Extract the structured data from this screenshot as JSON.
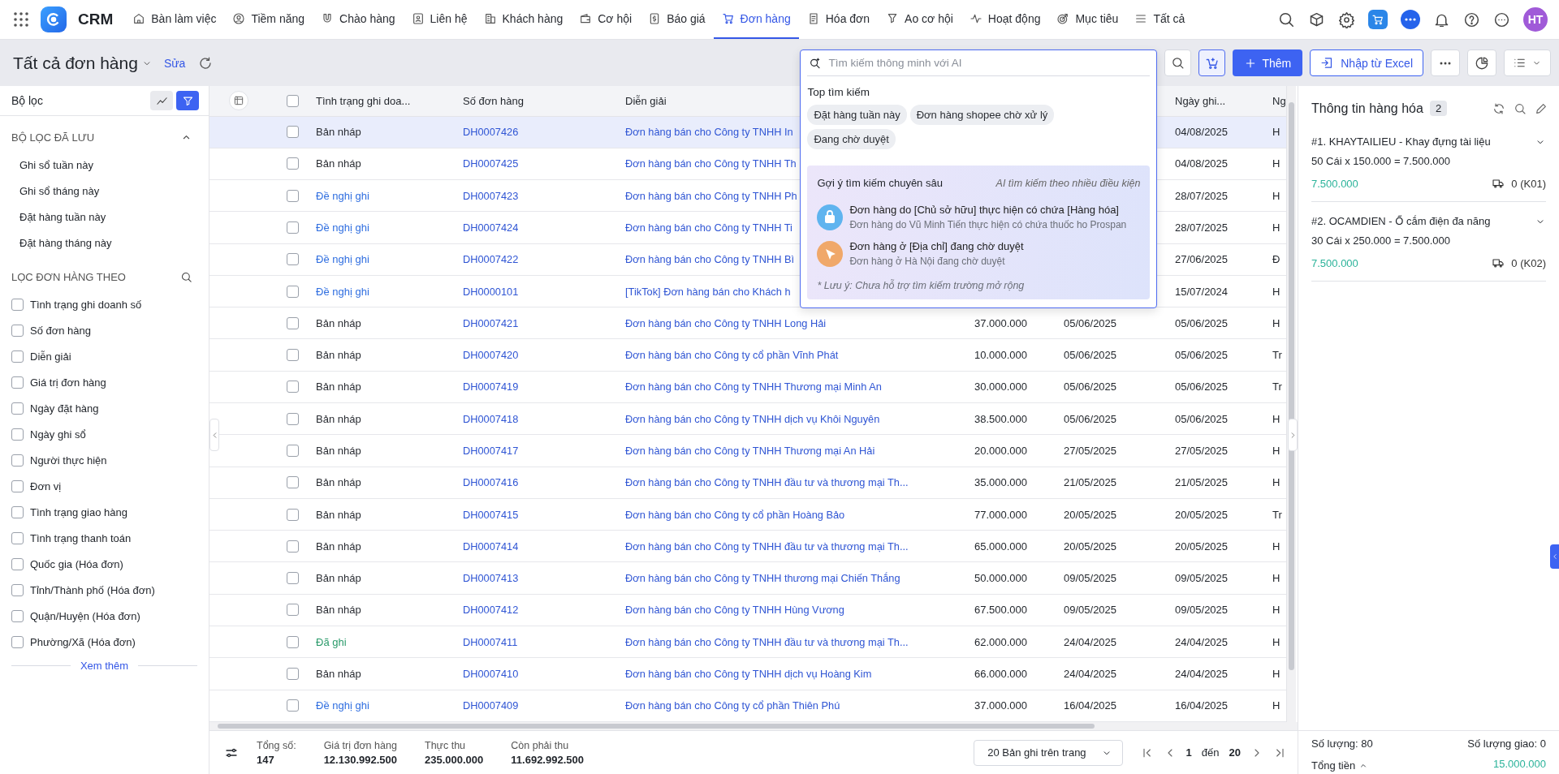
{
  "app": {
    "name": "CRM"
  },
  "nav": [
    {
      "label": "Bàn làm việc",
      "selected": false
    },
    {
      "label": "Tiềm năng",
      "selected": false
    },
    {
      "label": "Chào hàng",
      "selected": false
    },
    {
      "label": "Liên hệ",
      "selected": false
    },
    {
      "label": "Khách hàng",
      "selected": false
    },
    {
      "label": "Cơ hội",
      "selected": false
    },
    {
      "label": "Báo giá",
      "selected": false
    },
    {
      "label": "Đơn hàng",
      "selected": true
    },
    {
      "label": "Hóa đơn",
      "selected": false
    },
    {
      "label": "Ao cơ hội",
      "selected": false
    },
    {
      "label": "Hoạt động",
      "selected": false
    },
    {
      "label": "Mục tiêu",
      "selected": false
    },
    {
      "label": "Tất cả",
      "selected": false
    }
  ],
  "user": {
    "initials": "HT"
  },
  "toolbar": {
    "title": "Tất cả đơn hàng",
    "edit_link": "Sửa",
    "add_button": "Thêm",
    "import_button": "Nhập từ Excel"
  },
  "search": {
    "placeholder": "Tìm kiếm thông minh với AI",
    "top_title": "Top tìm kiếm",
    "chips": [
      "Đặt hàng tuần này",
      "Đơn hàng shopee chờ xử lý",
      "Đang chờ duyệt"
    ],
    "deep": {
      "title": "Gợi ý tìm kiếm chuyên sâu",
      "subtitle": "AI tìm kiếm theo nhiều điều kiện",
      "suggestions": [
        {
          "title": "Đơn hàng do [Chủ sở hữu] thực hiện có chứa [Hàng hóa]",
          "example": "Đơn hàng do Vũ Minh Tiến thực hiện có chứa thuốc ho Prospan"
        },
        {
          "title": "Đơn hàng ở [Địa chỉ] đang chờ duyệt",
          "example": "Đơn hàng ở Hà Nội đang chờ duyệt"
        }
      ],
      "note": "* Lưu ý: Chưa hỗ trợ tìm kiếm trường mở rộng"
    }
  },
  "filters": {
    "title": "Bộ lọc",
    "saved_title": "BỘ LỌC ĐÃ LƯU",
    "saved_expanded": true,
    "saved": [
      "Ghi sổ tuần này",
      "Ghi sổ tháng này",
      "Đặt hàng tuần này",
      "Đặt hàng tháng này"
    ],
    "by_title": "LỌC ĐƠN HÀNG THEO",
    "fields": [
      {
        "label": "Tình trạng ghi doanh số",
        "checked": false
      },
      {
        "label": "Số đơn hàng",
        "checked": false
      },
      {
        "label": "Diễn giải",
        "checked": false
      },
      {
        "label": "Giá trị đơn hàng",
        "checked": false
      },
      {
        "label": "Ngày đặt hàng",
        "checked": false
      },
      {
        "label": "Ngày ghi sổ",
        "checked": false
      },
      {
        "label": "Người thực hiện",
        "checked": false
      },
      {
        "label": "Đơn vị",
        "checked": false
      },
      {
        "label": "Tình trạng giao hàng",
        "checked": false
      },
      {
        "label": "Tình trạng thanh toán",
        "checked": false
      },
      {
        "label": "Quốc gia (Hóa đơn)",
        "checked": false
      },
      {
        "label": "Tỉnh/Thành phố (Hóa đơn)",
        "checked": false
      },
      {
        "label": "Quận/Huyện (Hóa đơn)",
        "checked": false
      },
      {
        "label": "Phường/Xã (Hóa đơn)",
        "checked": false
      }
    ],
    "more": "Xem thêm"
  },
  "table": {
    "headers": {
      "status": "Tình trạng ghi doa...",
      "number": "Số đơn hàng",
      "description": "Diễn giải",
      "record_date": "Ngày ghi...",
      "column_8": "Ng"
    },
    "all_checked": false,
    "rows": [
      {
        "selected": true,
        "checked": false,
        "status": "Bản nháp",
        "color": "#2a2d33",
        "number": "DH0007426",
        "description": "Đơn hàng bán cho Công ty TNHH In",
        "record_date": "04/08/2025",
        "column_8": "H"
      },
      {
        "selected": false,
        "checked": false,
        "status": "Bản nháp",
        "color": "#2a2d33",
        "number": "DH0007425",
        "description": "Đơn hàng bán cho Công ty TNHH Th",
        "record_date": "04/08/2025",
        "column_8": "H"
      },
      {
        "selected": false,
        "checked": false,
        "status": "Đề nghị ghi",
        "color": "#2f6ee0",
        "number": "DH0007423",
        "description": "Đơn hàng bán cho Công ty TNHH Ph",
        "record_date": "28/07/2025",
        "column_8": "H"
      },
      {
        "selected": false,
        "checked": false,
        "status": "Đề nghị ghi",
        "color": "#2f6ee0",
        "number": "DH0007424",
        "description": "Đơn hàng bán cho Công ty TNHH Ti",
        "record_date": "28/07/2025",
        "column_8": "H"
      },
      {
        "selected": false,
        "checked": false,
        "status": "Đề nghị ghi",
        "color": "#2f6ee0",
        "number": "DH0007422",
        "description": "Đơn hàng bán cho Công ty TNHH Bì",
        "record_date": "27/06/2025",
        "column_8": "Đ"
      },
      {
        "selected": false,
        "checked": false,
        "status": "Đề nghị ghi",
        "color": "#2f6ee0",
        "number": "DH0000101",
        "description": "[TikTok] Đơn hàng bán cho Khách h",
        "record_date": "15/07/2024",
        "column_8": "H"
      },
      {
        "selected": false,
        "checked": false,
        "status": "Bản nháp",
        "color": "#2a2d33",
        "number": "DH0007421",
        "description": "Đơn hàng bán cho Công ty TNHH Long Hải",
        "value": "37.000.000",
        "order_date": "05/06/2025",
        "record_date": "05/06/2025",
        "column_8": "H"
      },
      {
        "selected": false,
        "checked": false,
        "status": "Bản nháp",
        "color": "#2a2d33",
        "number": "DH0007420",
        "description": "Đơn hàng bán cho Công ty cổ phần Vĩnh Phát",
        "value": "10.000.000",
        "order_date": "05/06/2025",
        "record_date": "05/06/2025",
        "column_8": "Tr"
      },
      {
        "selected": false,
        "checked": false,
        "status": "Bản nháp",
        "color": "#2a2d33",
        "number": "DH0007419",
        "description": "Đơn hàng bán cho Công ty TNHH Thương mại Minh An",
        "value": "30.000.000",
        "order_date": "05/06/2025",
        "record_date": "05/06/2025",
        "column_8": "Tr"
      },
      {
        "selected": false,
        "checked": false,
        "status": "Bản nháp",
        "color": "#2a2d33",
        "number": "DH0007418",
        "description": "Đơn hàng bán cho Công ty TNHH dịch vụ Khôi Nguyên",
        "value": "38.500.000",
        "order_date": "05/06/2025",
        "record_date": "05/06/2025",
        "column_8": "H"
      },
      {
        "selected": false,
        "checked": false,
        "status": "Bản nháp",
        "color": "#2a2d33",
        "number": "DH0007417",
        "description": "Đơn hàng bán cho Công ty TNHH Thương mại An Hải",
        "value": "20.000.000",
        "order_date": "27/05/2025",
        "record_date": "27/05/2025",
        "column_8": "H"
      },
      {
        "selected": false,
        "checked": false,
        "status": "Bản nháp",
        "color": "#2a2d33",
        "number": "DH0007416",
        "description": "Đơn hàng bán cho Công ty TNHH đầu tư và thương mại Th...",
        "value": "35.000.000",
        "order_date": "21/05/2025",
        "record_date": "21/05/2025",
        "column_8": "H"
      },
      {
        "selected": false,
        "checked": false,
        "status": "Bản nháp",
        "color": "#2a2d33",
        "number": "DH0007415",
        "description": "Đơn hàng bán cho Công ty cổ phần Hoàng Bảo",
        "value": "77.000.000",
        "order_date": "20/05/2025",
        "record_date": "20/05/2025",
        "column_8": "Tr"
      },
      {
        "selected": false,
        "checked": false,
        "status": "Bản nháp",
        "color": "#2a2d33",
        "number": "DH0007414",
        "description": "Đơn hàng bán cho Công ty TNHH đầu tư và thương mại Th...",
        "value": "65.000.000",
        "order_date": "20/05/2025",
        "record_date": "20/05/2025",
        "column_8": "H"
      },
      {
        "selected": false,
        "checked": false,
        "status": "Bản nháp",
        "color": "#2a2d33",
        "number": "DH0007413",
        "description": "Đơn hàng bán cho Công ty TNHH thương mại Chiến Thắng",
        "value": "50.000.000",
        "order_date": "09/05/2025",
        "record_date": "09/05/2025",
        "column_8": "H"
      },
      {
        "selected": false,
        "checked": false,
        "status": "Bản nháp",
        "color": "#2a2d33",
        "number": "DH0007412",
        "description": "Đơn hàng bán cho Công ty TNHH Hùng Vương",
        "value": "67.500.000",
        "order_date": "09/05/2025",
        "record_date": "09/05/2025",
        "column_8": "H"
      },
      {
        "selected": false,
        "checked": false,
        "status": "Đã ghi",
        "color": "#2a9a6a",
        "number": "DH0007411",
        "description": "Đơn hàng bán cho Công ty TNHH đầu tư và thương mại Th...",
        "value": "62.000.000",
        "order_date": "24/04/2025",
        "record_date": "24/04/2025",
        "column_8": "H"
      },
      {
        "selected": false,
        "checked": false,
        "status": "Bản nháp",
        "color": "#2a2d33",
        "number": "DH0007410",
        "description": "Đơn hàng bán cho Công ty TNHH dịch vụ Hoàng Kim",
        "value": "66.000.000",
        "order_date": "24/04/2025",
        "record_date": "24/04/2025",
        "column_8": "H"
      },
      {
        "selected": false,
        "checked": false,
        "status": "Đề nghị ghi",
        "color": "#2f6ee0",
        "number": "DH0007409",
        "description": "Đơn hàng bán cho Công ty cổ phần Thiên Phú",
        "value": "37.000.000",
        "order_date": "16/04/2025",
        "record_date": "16/04/2025",
        "column_8": "H"
      }
    ]
  },
  "footer": {
    "stats": [
      {
        "label": "Tổng số:",
        "value": "147"
      },
      {
        "label": "Giá trị đơn hàng",
        "value": "12.130.992.500"
      },
      {
        "label": "Thực thu",
        "value": "235.000.000"
      },
      {
        "label": "Còn phải thu",
        "value": "11.692.992.500"
      }
    ],
    "page_size": "20 Bản ghi trên trang",
    "page": "1",
    "to": "đến",
    "pages": "20"
  },
  "detail": {
    "title": "Thông tin hàng hóa",
    "count": "2",
    "items": [
      {
        "title": "#1. KHAYTAILIEU - Khay đựng tài liệu",
        "formula": "50 Cái x 150.000 = 7.500.000",
        "amount": "7.500.000",
        "delivered": "0 (K01)",
        "expanded": false
      },
      {
        "title": "#2. OCAMDIEN - Ổ cắm điện đa năng",
        "formula": "30 Cái x 250.000 = 7.500.000",
        "amount": "7.500.000",
        "delivered": "0 (K02)",
        "expanded": false
      }
    ],
    "quantity": "Số lượng: 80",
    "delivered_qty": "Số lượng giao: 0",
    "total_label": "Tổng tiền",
    "total": "15.000.000"
  }
}
